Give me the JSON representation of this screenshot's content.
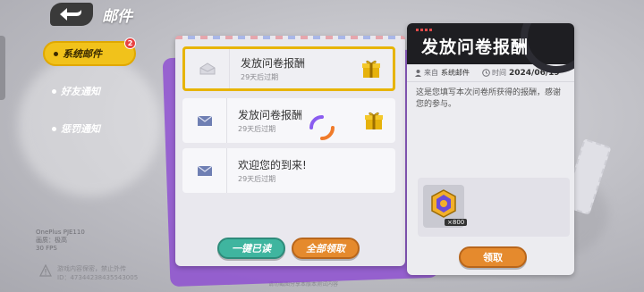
{
  "header": {
    "title": "邮件"
  },
  "nav": {
    "items": [
      {
        "label": "系统邮件",
        "badge": "2",
        "active": true
      },
      {
        "label": "好友通知",
        "active": false
      },
      {
        "label": "惩罚通知",
        "active": false
      }
    ]
  },
  "mails": [
    {
      "title": "发放问卷报酬",
      "expire": "29天后过期",
      "has_gift": true,
      "selected": true
    },
    {
      "title": "发放问卷报酬",
      "expire": "29天后过期",
      "has_gift": true,
      "selected": false
    },
    {
      "title": "欢迎您的到来!",
      "expire": "29天后过期",
      "has_gift": false,
      "selected": false
    }
  ],
  "actions": {
    "read_all": "一键已读",
    "claim_all": "全部领取"
  },
  "detail": {
    "title": "发放问卷报酬",
    "from_label": "来自",
    "from_value": "系统邮件",
    "time_label": "时间",
    "time_value": "2024/06/19",
    "body": "这是您填写本次问卷所获得的报酬，感谢您的参与。",
    "reward_count": "×800",
    "claim_label": "领取"
  },
  "device_info": {
    "line1": "OnePlus PJE110",
    "line2": "画质：极高",
    "line3": "30 FPS"
  },
  "warning": {
    "line1": "游戏内容保密，禁止外传",
    "line2": "ID：47344238435543005"
  },
  "footer_note": "请勿截图分享本版本测试内容",
  "colors": {
    "accent": "#f1c21b",
    "primary_btn": "#e58a2d",
    "secondary_btn": "#3fb59f"
  }
}
